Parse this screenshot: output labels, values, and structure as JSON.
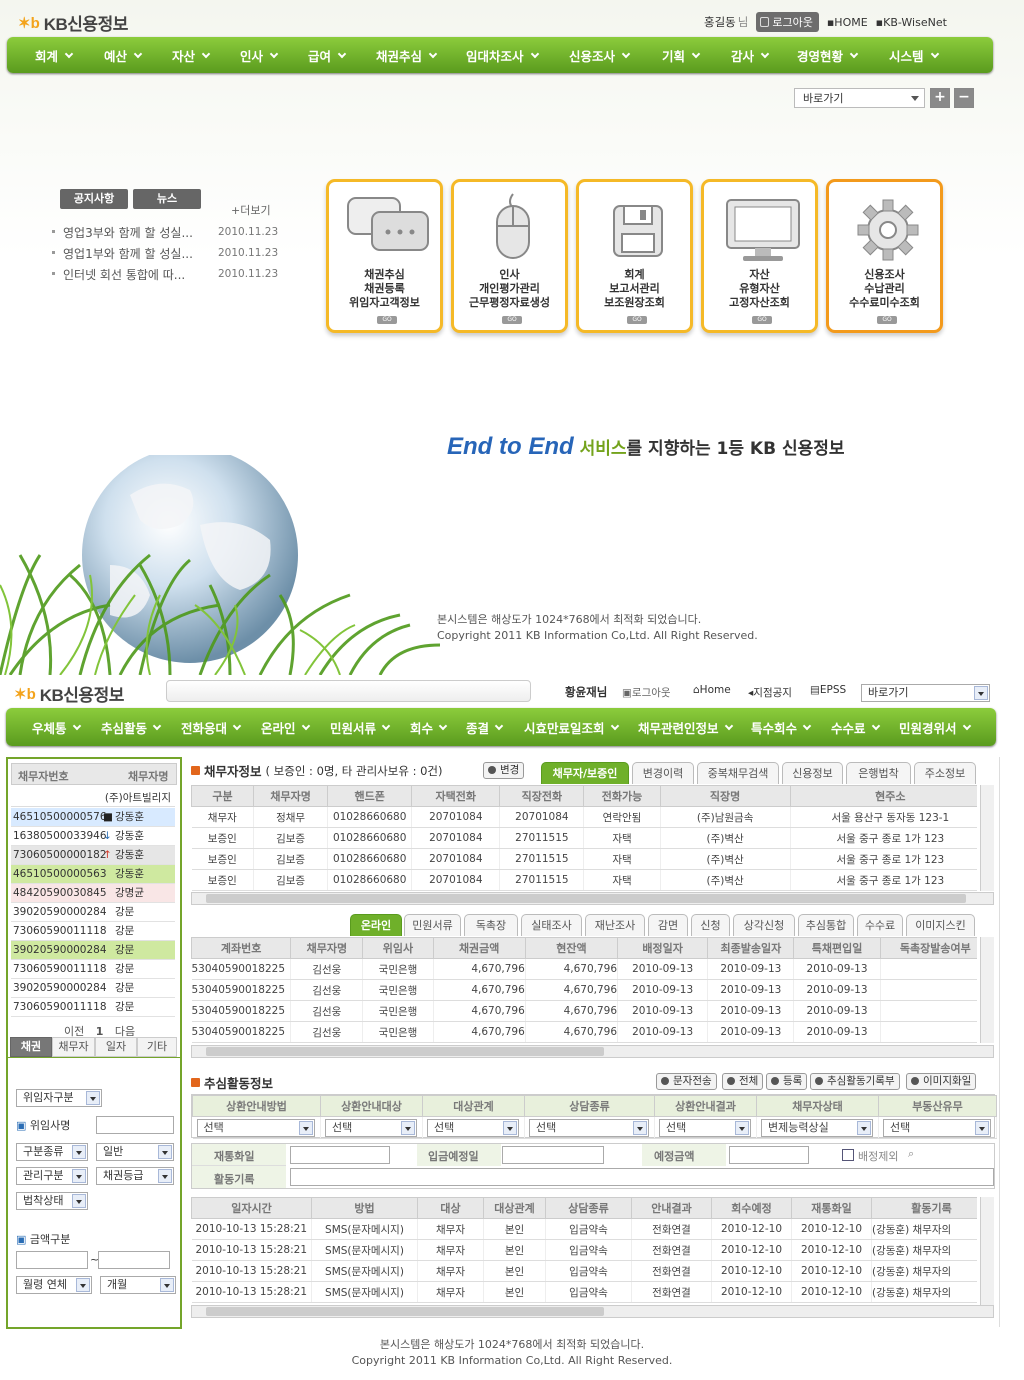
{
  "top": {
    "logo_text": "KB신용정보",
    "user_name": "홍길동",
    "user_suffix": "님",
    "logout_label": "로그아웃",
    "home_link": "HOME",
    "wisenet_link": "KB-WiseNet",
    "nav": [
      "회계",
      "예산",
      "자산",
      "인사",
      "급여",
      "채권추심",
      "임대차조사",
      "신용조사",
      "기획",
      "감사",
      "경영현황",
      "시스템"
    ],
    "quick_select": "바로가기",
    "tab_notice": "공지사항",
    "tab_news": "뉴스",
    "more_label": "+더보기",
    "notices": [
      {
        "title": "영업3부와 함께 할 성실...",
        "date": "2010.11.23"
      },
      {
        "title": "영업1부와 함께 할 성실...",
        "date": "2010.11.23"
      },
      {
        "title": "인터넷 회선 통합에 따...",
        "date": "2010.11.23"
      }
    ],
    "cards": [
      {
        "lines": [
          "채권추심",
          "채권등록",
          "위임자고객정보"
        ],
        "icon": "chat-icon"
      },
      {
        "lines": [
          "인사",
          "개인평가관리",
          "근무평정자료생성"
        ],
        "icon": "mouse-icon"
      },
      {
        "lines": [
          "회계",
          "보고서관리",
          "보조원장조회"
        ],
        "icon": "floppy-icon"
      },
      {
        "lines": [
          "자산",
          "유형자산",
          "고정자산조회"
        ],
        "icon": "monitor-icon"
      },
      {
        "lines": [
          "신용조사",
          "수납관리",
          "수수료미수조회"
        ],
        "icon": "gear-icon"
      }
    ],
    "go_label": "GO",
    "slogan_e2e": "End to End",
    "slogan_svc": "서비스",
    "slogan_rest": "를 지향하는 1등 KB 신용정보",
    "footer_line1": "본시스템은 해상도가 1024*768에서 최적화 되었습니다.",
    "footer_line2": "Copyright 2011 KB Information Co,Ltd. All Right Reserved."
  },
  "bot": {
    "logo_text": "KB신용정보",
    "user_name": "황윤재님",
    "logout_label": "로그아웃",
    "home_label": "Home",
    "branch_notice": "지점공지",
    "epss": "EPSS",
    "quick_select": "바로가기",
    "nav": [
      "우체통",
      "추심활동",
      "전화응대",
      "온라인",
      "민원서류",
      "회수",
      "종결",
      "시효만료일조회",
      "채무관련인정보",
      "특수회수",
      "수수료",
      "민원경위서"
    ],
    "sidebar": {
      "col1": "채무자번호",
      "col2": "채무자명",
      "first_row": "(주)아트빌리지",
      "rows": [
        {
          "no": "46510500000576",
          "mark": "■",
          "name": "강동훈",
          "style": "sel"
        },
        {
          "no": "16380500033946",
          "mark": "↓",
          "name": "강동훈",
          "style": ""
        },
        {
          "no": "73060500000182",
          "mark": "↑",
          "name": "강동훈",
          "style": "gray"
        },
        {
          "no": "46510500000563",
          "mark": "",
          "name": "강동훈",
          "style": "green"
        },
        {
          "no": "48420590030845",
          "mark": "",
          "name": "강명균",
          "style": "pink"
        },
        {
          "no": "39020590000284",
          "mark": "",
          "name": "강문",
          "style": ""
        },
        {
          "no": "73060590011118",
          "mark": "",
          "name": "강문",
          "style": ""
        },
        {
          "no": "39020590000284",
          "mark": "",
          "name": "강문",
          "style": "green"
        },
        {
          "no": "73060590011118",
          "mark": "",
          "name": "강문",
          "style": ""
        },
        {
          "no": "39020590000284",
          "mark": "",
          "name": "강문",
          "style": ""
        },
        {
          "no": "73060590011118",
          "mark": "",
          "name": "강문",
          "style": ""
        }
      ],
      "prev": "이전",
      "page": "1",
      "next": "다음",
      "tabs": [
        "채권",
        "채무자",
        "일자",
        "기타"
      ],
      "delegator_select": "위임자구분",
      "delegator_name_label": "위임사명",
      "kind_select": "구분종류",
      "kind_value": "일반",
      "manage_select": "관리구분",
      "grade_select": "채권등급",
      "legal_select": "법착상태",
      "amount_label": "금액구분",
      "tilde": "~",
      "overdue_select": "월령 연체",
      "month_select": "개월"
    },
    "debtor": {
      "title": "채무자정보",
      "summary": "( 보증인 : 0명, 타 관리사보유 : 0건)",
      "change_btn": "변경",
      "tabs": [
        "채무자/보증인",
        "변경이력",
        "중복채무검색",
        "신용정보",
        "은행법착",
        "주소정보"
      ],
      "columns": [
        "구분",
        "채무자명",
        "핸드폰",
        "자택전화",
        "직장전화",
        "전화가능",
        "직장명",
        "현주소"
      ],
      "rows": [
        [
          "채무자",
          "정채무",
          "01028660680",
          "20701084",
          "20701084",
          "연락안됨",
          "(주)남원금속",
          "서울 용산구 동자동 123-1"
        ],
        [
          "보증인",
          "김보증",
          "01028660680",
          "20701084",
          "27011515",
          "자택",
          "(주)벽산",
          "서울 중구 종로 1가 123"
        ],
        [
          "보증인",
          "김보증",
          "01028660680",
          "20701084",
          "27011515",
          "자택",
          "(주)벽산",
          "서울 중구 종로 1가 123"
        ],
        [
          "보증인",
          "김보증",
          "01028660680",
          "20701084",
          "27011515",
          "자택",
          "(주)벽산",
          "서울 중구 종로 1가 123"
        ],
        [
          "보증인",
          "김보증",
          "01028660680",
          "20701084",
          "27011515",
          "자택",
          "(주)벽산",
          "서울 중구 종로 1가 123"
        ]
      ]
    },
    "account": {
      "tabs": [
        "온라인",
        "민원서류",
        "독촉장",
        "실태조사",
        "재난조사",
        "감면",
        "신청",
        "상각신청",
        "추심통합",
        "수수료",
        "이미지스킨"
      ],
      "columns": [
        "계좌번호",
        "채무자명",
        "위임사",
        "채권금액",
        "현잔액",
        "배정일자",
        "최종발송일자",
        "특채편입일",
        "독촉장발송여부"
      ],
      "rows": [
        [
          "53040590018225",
          "김선웅",
          "국민은행",
          "4,670,796",
          "4,670,796",
          "2010-09-13",
          "2010-09-13",
          "2010-09-13",
          ""
        ],
        [
          "53040590018225",
          "김선웅",
          "국민은행",
          "4,670,796",
          "4,670,796",
          "2010-09-13",
          "2010-09-13",
          "2010-09-13",
          ""
        ],
        [
          "53040590018225",
          "김선웅",
          "국민은행",
          "4,670,796",
          "4,670,796",
          "2010-09-13",
          "2010-09-13",
          "2010-09-13",
          ""
        ],
        [
          "53040590018225",
          "김선웅",
          "국민은행",
          "4,670,796",
          "4,670,796",
          "2010-09-13",
          "2010-09-13",
          "2010-09-13",
          ""
        ]
      ]
    },
    "activity": {
      "title": "추심활동정보",
      "buttons": [
        "문자전송",
        "전체",
        "등록",
        "추심활동기록부",
        "이미지화일"
      ],
      "filter_headers": [
        "상환안내방법",
        "상환안내대상",
        "대상관계",
        "상담종류",
        "상환안내결과",
        "채무자상태",
        "부동산유무"
      ],
      "filter_values": [
        "선택",
        "선택",
        "선택",
        "선택",
        "선택",
        "변제능력상실",
        "선택"
      ],
      "label_recontact": "재통화일",
      "label_deposit": "입금예정일",
      "label_amount": "예정금액",
      "label_exclude": "배정제외",
      "label_record": "활동기록",
      "columns": [
        "일자시간",
        "방법",
        "대상",
        "대상관계",
        "상담종류",
        "안내결과",
        "회수예정",
        "재통화일",
        "활동기록"
      ],
      "rows": [
        [
          "2010-10-13 15:28:21",
          "SMS(문자메시지)",
          "채무자",
          "본인",
          "입금약속",
          "전화연결",
          "2010-12-10",
          "2010-12-10",
          "(강동훈) 채무자의"
        ],
        [
          "2010-10-13 15:28:21",
          "SMS(문자메시지)",
          "채무자",
          "본인",
          "입금약속",
          "전화연결",
          "2010-12-10",
          "2010-12-10",
          "(강동훈) 채무자의"
        ],
        [
          "2010-10-13 15:28:21",
          "SMS(문자메시지)",
          "채무자",
          "본인",
          "입금약속",
          "전화연결",
          "2010-12-10",
          "2010-12-10",
          "(강동훈) 채무자의"
        ],
        [
          "2010-10-13 15:28:21",
          "SMS(문자메시지)",
          "채무자",
          "본인",
          "입금약속",
          "전화연결",
          "2010-12-10",
          "2010-12-10",
          "(강동훈) 채무자의"
        ]
      ]
    },
    "footer_line1": "본시스템은 해상도가 1024*768에서 최적화 되었습니다.",
    "footer_line2": "Copyright 2011 KB Information Co,Ltd. All Right Reserved."
  },
  "colors": {
    "nav_green": "#6fb02a",
    "card_border": "#f5b927",
    "accent_orange": "#e2661c",
    "slogan_blue": "#2765b8"
  }
}
